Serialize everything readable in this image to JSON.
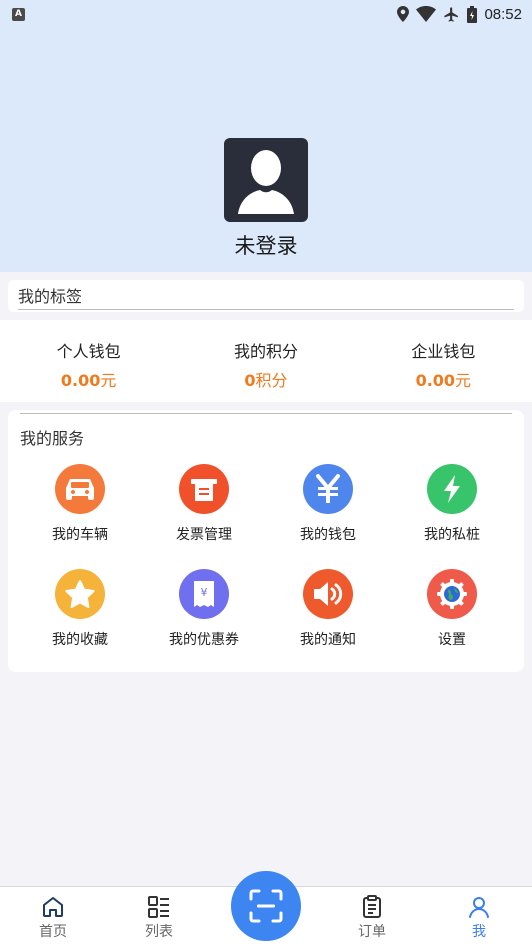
{
  "status_bar": {
    "time": "08:52",
    "indicator": "A"
  },
  "profile": {
    "login_text": "未登录"
  },
  "tags": {
    "title": "我的标签"
  },
  "wallet": [
    {
      "label": "个人钱包",
      "amount": "0.00",
      "unit": "元"
    },
    {
      "label": "我的积分",
      "amount": "0",
      "unit": "积分"
    },
    {
      "label": "企业钱包",
      "amount": "0.00",
      "unit": "元"
    }
  ],
  "services": {
    "title": "我的服务",
    "items": [
      {
        "label": "我的车辆",
        "icon": "car-icon",
        "color": "#f47a3c"
      },
      {
        "label": "发票管理",
        "icon": "invoice-icon",
        "color": "#f0512b"
      },
      {
        "label": "我的钱包",
        "icon": "yen-icon",
        "color": "#4f86ee"
      },
      {
        "label": "我的私桩",
        "icon": "lightning-icon",
        "color": "#37c46a"
      },
      {
        "label": "我的收藏",
        "icon": "star-icon",
        "color": "#f6b33a"
      },
      {
        "label": "我的优惠券",
        "icon": "coupon-icon",
        "color": "#6f6ff0"
      },
      {
        "label": "我的通知",
        "icon": "speaker-icon",
        "color": "#ee5a2c"
      },
      {
        "label": "设置",
        "icon": "gear-icon",
        "color": "#f05a4b"
      }
    ]
  },
  "nav": [
    {
      "label": "首页",
      "icon": "home-icon"
    },
    {
      "label": "列表",
      "icon": "list-icon"
    },
    {
      "label": "",
      "icon": "scan-icon"
    },
    {
      "label": "订单",
      "icon": "order-icon"
    },
    {
      "label": "我",
      "icon": "user-icon",
      "active": true
    }
  ]
}
